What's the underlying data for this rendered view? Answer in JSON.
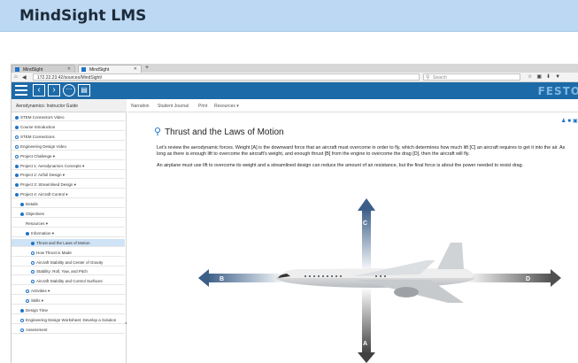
{
  "banner": {
    "title": "MindSight LMS"
  },
  "browser": {
    "tabs": [
      {
        "label": "MindSight"
      },
      {
        "label": "MindSight"
      }
    ],
    "new_tab": "+",
    "url": "172.22.23.42/sources/MindSight/",
    "search_placeholder": "Search"
  },
  "apptoolbar": {
    "brand": "FESTO"
  },
  "sidebar": {
    "header": "Aerodynamics: Instructor Guide",
    "items": [
      {
        "label": "STEM Connectors Video",
        "indent": 0,
        "marker": "fill"
      },
      {
        "label": "Course Introduction",
        "indent": 0,
        "marker": "fill"
      },
      {
        "label": "STEM Connections",
        "indent": 0,
        "marker": "open"
      },
      {
        "label": "Engineering Design Video",
        "indent": 0,
        "marker": "open"
      },
      {
        "label": "Project Challenge ▾",
        "indent": 0,
        "marker": "open"
      },
      {
        "label": "Project 1: Aerodynamics Concepts ▾",
        "indent": 0,
        "marker": "fill"
      },
      {
        "label": "Project 2: Airfoil Design ▾",
        "indent": 0,
        "marker": "fill"
      },
      {
        "label": "Project 3: Streamlined Design ▾",
        "indent": 0,
        "marker": "fill"
      },
      {
        "label": "Project 4: Aircraft Control ▾",
        "indent": 0,
        "marker": "fill"
      },
      {
        "label": "Details",
        "indent": 1,
        "marker": "fill"
      },
      {
        "label": "Objectives",
        "indent": 1,
        "marker": "fill"
      },
      {
        "label": "Resources ▾",
        "indent": 2,
        "marker": "none"
      },
      {
        "label": "Information ▾",
        "indent": 2,
        "marker": "fill"
      },
      {
        "label": "Thrust and the Laws of Motion",
        "indent": 3,
        "marker": "fill",
        "active": true
      },
      {
        "label": "How Thrust is Made",
        "indent": 3,
        "marker": "open"
      },
      {
        "label": "Aircraft Stability and Center of Gravity",
        "indent": 3,
        "marker": "open"
      },
      {
        "label": "Stability: Roll, Yaw, and Pitch",
        "indent": 3,
        "marker": "open"
      },
      {
        "label": "Aircraft Stability and Control Surfaces",
        "indent": 3,
        "marker": "open"
      },
      {
        "label": "Activities ▾",
        "indent": 2,
        "marker": "open"
      },
      {
        "label": "Skills ▾",
        "indent": 2,
        "marker": "open"
      },
      {
        "label": "Design Time",
        "indent": 1,
        "marker": "fill"
      },
      {
        "label": "Engineering Design Worksheet: Develop a Solution",
        "indent": 1,
        "marker": "open"
      },
      {
        "label": "Assessment",
        "indent": 1,
        "marker": "open"
      }
    ]
  },
  "content": {
    "tabs": [
      "Narration",
      "Student Journal",
      "Print",
      "Resources ▾"
    ],
    "heading": "Thrust and the Laws of Motion",
    "para1": "Let's review the aerodynamic forces. Weight [A] is the downward force that an aircraft must overcome in order to fly, which determines how much lift [C] an aircraft requires to get it into the air. As long as there is enough lift to overcome the aircraft's weight, and enough thrust [B] from the engine to overcome the drag [D], then the aircraft will fly.",
    "para2": "An airplane must use lift to overcome its weight and a streamlined design can reduce the amount of air resistance, but the final force is about the power needed to resist drag.",
    "diagram": {
      "labels": {
        "lift": "C",
        "weight": "A",
        "thrust": "B",
        "drag": "D"
      }
    }
  },
  "colors": {
    "accent": "#1f74c8",
    "toolbar": "#1d6aa8",
    "banner": "#bcd8f2"
  }
}
